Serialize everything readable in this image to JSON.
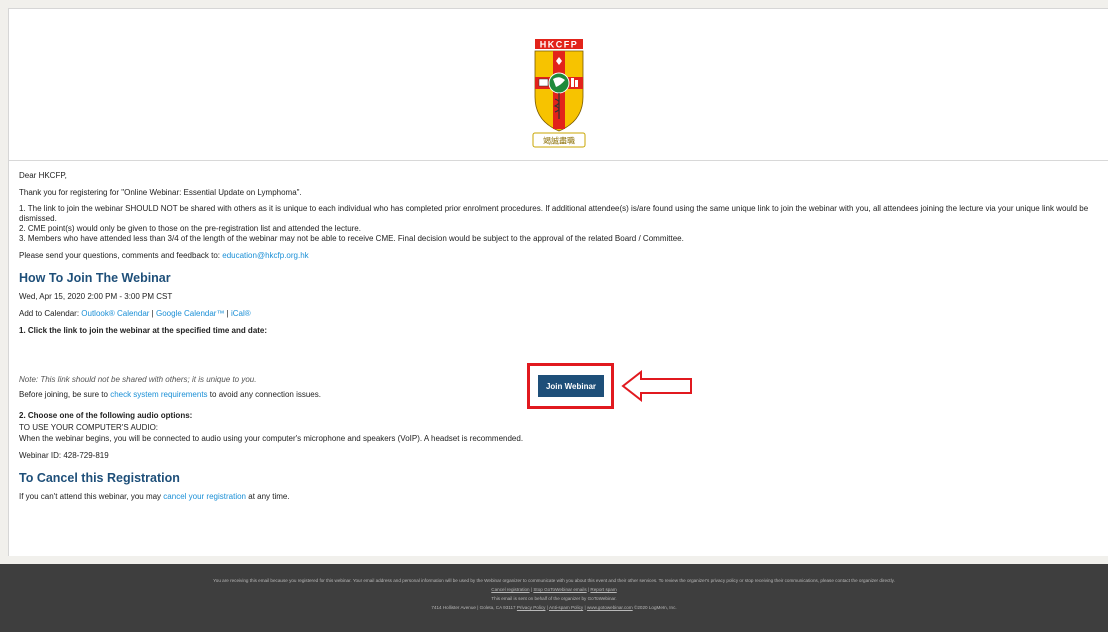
{
  "logo": {
    "text": "HKCFP",
    "motto": "竭誠盡職",
    "colors": {
      "red": "#e2231a",
      "yellow": "#f7c300",
      "green": "#1f8a3b"
    }
  },
  "greeting": "Dear HKCFP,",
  "intro": "Thank you for registering for \"Online Webinar: Essential Update on Lymphoma\".",
  "rules": [
    "1. The link to join the webinar SHOULD NOT be shared with others as it is unique to each individual who has completed prior enrolment procedures. If additional attendee(s) is/are found using the same unique link to join the webinar with you, all attendees joining the lecture via your unique link would be dismissed.",
    "2. CME point(s) would only be given to those on the pre-registration list and attended the lecture.",
    "3. Members who have attended less than 3/4 of the length of the webinar may not be able to receive CME. Final decision would be subject to the approval of the related Board / Committee."
  ],
  "contact": {
    "prefix": "Please send your questions, comments and feedback to:",
    "email": "education@hkcfp.org.hk"
  },
  "join": {
    "heading": "How To Join The Webinar",
    "datetime": "Wed, Apr 15, 2020 2:00 PM - 3:00 PM CST",
    "calendar_prefix": "Add to Calendar:",
    "calendar_outlook": "Outlook® Calendar",
    "calendar_google": "Google Calendar™",
    "calendar_ical": "iCal®",
    "step1": "1. Click the link to join the webinar at the specified time and date:",
    "button_label": "Join Webinar",
    "note": "Note: This link should not be shared with others; it is unique to you.",
    "before_prefix": "Before joining, be sure to",
    "before_link": "check system requirements",
    "before_suffix": "to avoid any connection issues.",
    "step2": "2. Choose one of the following audio options:",
    "audio_title": "TO USE YOUR COMPUTER'S AUDIO:",
    "audio_desc": "When the webinar begins, you will be connected to audio using your computer's microphone and speakers (VoIP). A headset is recommended.",
    "webinar_id": "Webinar ID: 428-729-819"
  },
  "cancel": {
    "heading": "To Cancel this Registration",
    "prefix": "If you can't attend this webinar, you may",
    "link": "cancel your registration",
    "suffix": "at any time."
  },
  "footer": {
    "notice": "You are receiving this email because you registered for this webinar. Your email address and personal information will be used by the Webinar organizer to communicate with you about this event and their other services. To review the organizer's privacy policy or stop receiving their communications, please contact the organizer directly.",
    "link_cancel": "Cancel registration",
    "link_stop": "Stop GoToWebinar emails",
    "link_spam": "Report spam",
    "behalf": "This email is sent on behalf of the organizer by GoToWebinar.",
    "address": "7414 Hollister Avenue | Goleta, CA 93117",
    "link_privacy": "Privacy Policy",
    "link_antispam": "Anti-spam Policy",
    "link_site": "www.gotowebinar.com",
    "copyright": "©2020 LogMeIn, Inc."
  },
  "colors": {
    "heading": "#1e4f79",
    "link": "#1a8fd6",
    "button": "#1e4f79",
    "highlight": "#e1191f",
    "footer_bg": "#3e3e3e"
  }
}
